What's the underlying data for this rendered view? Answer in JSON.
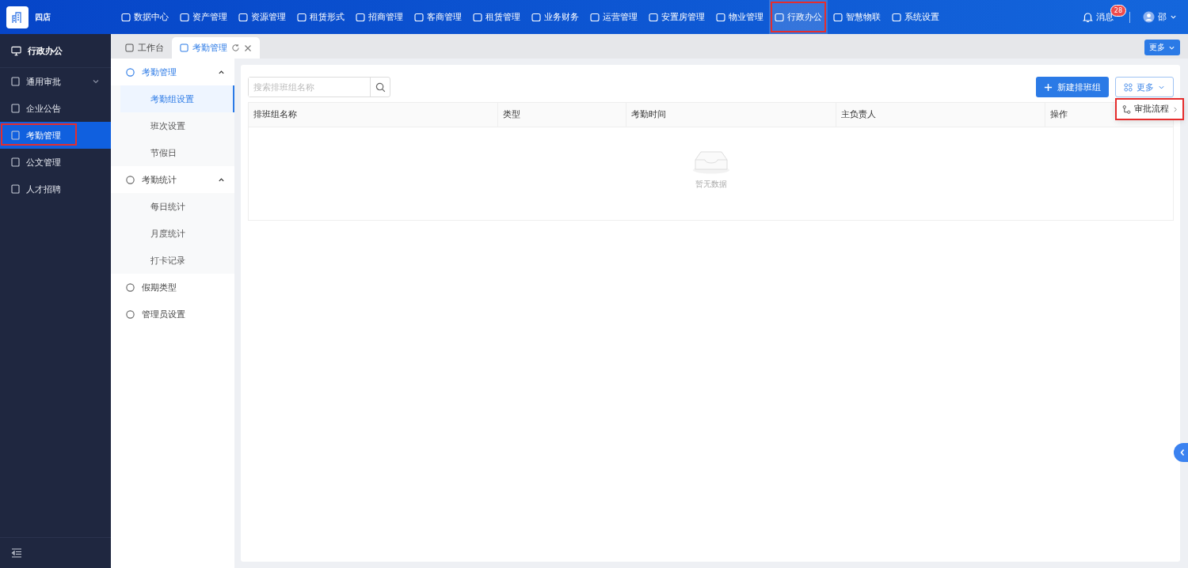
{
  "brand": {
    "name": "四店"
  },
  "top_nav": [
    {
      "label": "数据中心",
      "selected": false,
      "highlighted": false
    },
    {
      "label": "资产管理",
      "selected": false,
      "highlighted": false
    },
    {
      "label": "资源管理",
      "selected": false,
      "highlighted": false
    },
    {
      "label": "租赁形式",
      "selected": false,
      "highlighted": false
    },
    {
      "label": "招商管理",
      "selected": false,
      "highlighted": false
    },
    {
      "label": "客商管理",
      "selected": false,
      "highlighted": false
    },
    {
      "label": "租赁管理",
      "selected": false,
      "highlighted": false
    },
    {
      "label": "业务财务",
      "selected": false,
      "highlighted": false
    },
    {
      "label": "运营管理",
      "selected": false,
      "highlighted": false
    },
    {
      "label": "安置房管理",
      "selected": false,
      "highlighted": false
    },
    {
      "label": "物业管理",
      "selected": false,
      "highlighted": false
    },
    {
      "label": "行政办公",
      "selected": true,
      "highlighted": true
    },
    {
      "label": "智慧物联",
      "selected": false,
      "highlighted": false
    },
    {
      "label": "系统设置",
      "selected": false,
      "highlighted": false
    }
  ],
  "messages": {
    "label": "消息",
    "badge": "28"
  },
  "user": {
    "name": "邵"
  },
  "sidebar": {
    "title": "行政办公",
    "items": [
      {
        "label": "通用审批",
        "selected": false,
        "highlighted": false,
        "expandable": true
      },
      {
        "label": "企业公告",
        "selected": false,
        "highlighted": false,
        "expandable": false
      },
      {
        "label": "考勤管理",
        "selected": true,
        "highlighted": true,
        "expandable": false
      },
      {
        "label": "公文管理",
        "selected": false,
        "highlighted": false,
        "expandable": false
      },
      {
        "label": "人才招聘",
        "selected": false,
        "highlighted": false,
        "expandable": false
      }
    ]
  },
  "tabs": [
    {
      "label": "工作台",
      "selected": false
    },
    {
      "label": "考勤管理",
      "selected": true
    }
  ],
  "tabs_more": "更多",
  "sub_menu": [
    {
      "label": "考勤管理",
      "expanded": true,
      "children": [
        {
          "label": "考勤组设置",
          "selected": true
        },
        {
          "label": "班次设置",
          "selected": false
        },
        {
          "label": "节假日",
          "selected": false
        }
      ]
    },
    {
      "label": "考勤统计",
      "expanded": true,
      "children": [
        {
          "label": "每日统计",
          "selected": false
        },
        {
          "label": "月度统计",
          "selected": false
        },
        {
          "label": "打卡记录",
          "selected": false
        }
      ]
    },
    {
      "label": "假期类型"
    },
    {
      "label": "管理员设置"
    }
  ],
  "search": {
    "placeholder": "搜索排班组名称"
  },
  "buttons": {
    "create": "新建排班组",
    "more": "更多"
  },
  "more_menu": [
    {
      "label": "审批流程",
      "highlighted": true
    }
  ],
  "table": {
    "columns": [
      "排班组名称",
      "类型",
      "考勤时间",
      "主负责人",
      "操作"
    ],
    "empty_text": "暂无数据"
  }
}
